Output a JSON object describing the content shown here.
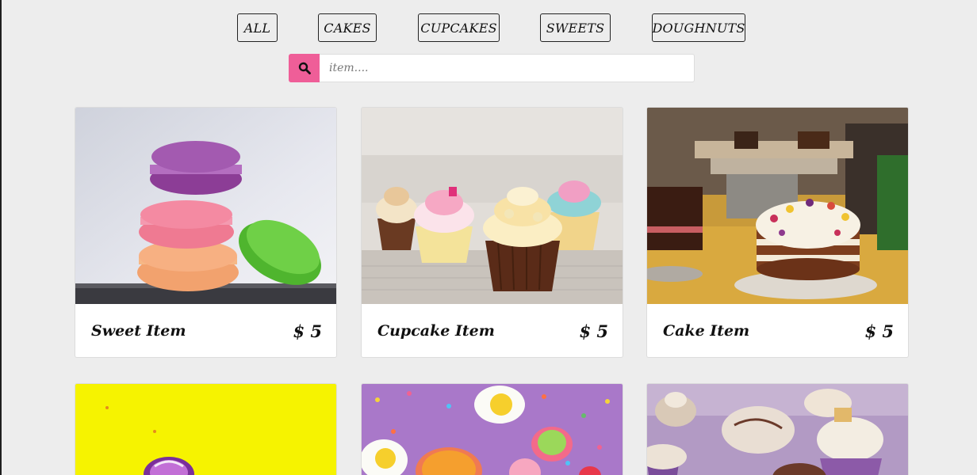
{
  "filters": [
    {
      "label": "ALL"
    },
    {
      "label": "CAKES"
    },
    {
      "label": "CUPCAKES"
    },
    {
      "label": "SWEETS"
    },
    {
      "label": "DOUGHNUTS"
    }
  ],
  "search": {
    "placeholder": "item....",
    "icon": "search-icon",
    "accent": "#ef5e98"
  },
  "items": [
    {
      "title": "Sweet Item",
      "price": "$ 5",
      "image": "macarons"
    },
    {
      "title": "Cupcake Item",
      "price": "$ 5",
      "image": "cupcakes"
    },
    {
      "title": "Cake Item",
      "price": "$ 5",
      "image": "cake"
    },
    {
      "image": "doughnut-yellow"
    },
    {
      "image": "sweets-purple"
    },
    {
      "image": "cupcakes-lavender"
    }
  ]
}
